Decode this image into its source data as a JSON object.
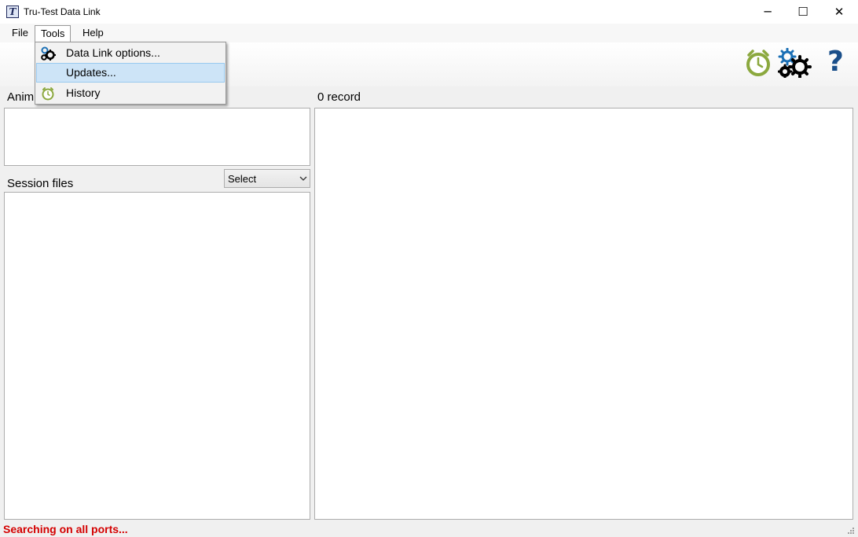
{
  "window": {
    "title": "Tru-Test Data Link",
    "app_icon_letter": "T",
    "minimize_glyph": "─",
    "maximize_glyph": "☐",
    "close_glyph": "✕"
  },
  "menubar": {
    "items": [
      {
        "label": "File"
      },
      {
        "label": "Tools"
      },
      {
        "label": "Help"
      }
    ]
  },
  "tools_menu": {
    "items": [
      {
        "label": "Data Link options...",
        "icon": "gears-icon"
      },
      {
        "label": "Updates...",
        "icon": "",
        "highlighted": true
      },
      {
        "label": "History",
        "icon": "clock-icon"
      }
    ]
  },
  "toolbar": {
    "icons": [
      "history-clock-icon",
      "settings-gears-icon",
      "help-icon"
    ],
    "help_glyph": "?"
  },
  "panels": {
    "animals_label": "Anim",
    "record_label": "0 record",
    "session_label": "Session files",
    "select_value": "Select"
  },
  "status": {
    "text": "Searching on all ports..."
  },
  "colors": {
    "status_red": "#d40000",
    "clock_green": "#8ba83e",
    "gear_blue": "#1a6fb5",
    "help_blue": "#1a4f8a",
    "highlight": "#cde4f7"
  }
}
